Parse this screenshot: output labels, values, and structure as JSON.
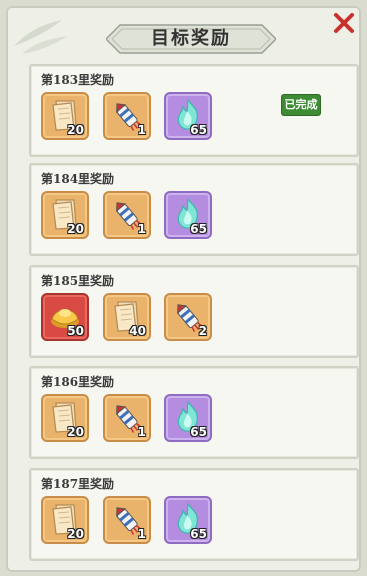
{
  "header": {
    "title": "目标奖励"
  },
  "rewards": [
    {
      "title": "第183里奖励",
      "completed": true,
      "status_label": "已完成",
      "items": [
        {
          "icon": "paper-scroll-icon",
          "qty": "20",
          "color": "orange"
        },
        {
          "icon": "firework-rocket-icon",
          "qty": "1",
          "color": "orange"
        },
        {
          "icon": "blue-spirit-flame-icon",
          "qty": "65",
          "color": "purple"
        }
      ]
    },
    {
      "title": "第184里奖励",
      "completed": false,
      "items": [
        {
          "icon": "paper-scroll-icon",
          "qty": "20",
          "color": "orange"
        },
        {
          "icon": "firework-rocket-icon",
          "qty": "1",
          "color": "orange"
        },
        {
          "icon": "blue-spirit-flame-icon",
          "qty": "65",
          "color": "purple"
        }
      ]
    },
    {
      "title": "第185里奖励",
      "completed": false,
      "items": [
        {
          "icon": "gold-ingot-icon",
          "qty": "50",
          "color": "red"
        },
        {
          "icon": "paper-scroll-icon",
          "qty": "40",
          "color": "orange"
        },
        {
          "icon": "firework-rocket-icon",
          "qty": "2",
          "color": "orange"
        }
      ]
    },
    {
      "title": "第186里奖励",
      "completed": false,
      "items": [
        {
          "icon": "paper-scroll-icon",
          "qty": "20",
          "color": "orange"
        },
        {
          "icon": "firework-rocket-icon",
          "qty": "1",
          "color": "orange"
        },
        {
          "icon": "blue-spirit-flame-icon",
          "qty": "65",
          "color": "purple"
        }
      ]
    },
    {
      "title": "第187里奖励",
      "completed": false,
      "items": [
        {
          "icon": "paper-scroll-icon",
          "qty": "20",
          "color": "orange"
        },
        {
          "icon": "firework-rocket-icon",
          "qty": "1",
          "color": "orange"
        },
        {
          "icon": "blue-spirit-flame-icon",
          "qty": "65",
          "color": "purple"
        }
      ]
    }
  ],
  "colors": {
    "frame_orange": "#e9b36b",
    "frame_purple": "#b58de0",
    "frame_red": "#d94a45",
    "done_green": "#3d8b34",
    "close_red": "#c8322d"
  }
}
